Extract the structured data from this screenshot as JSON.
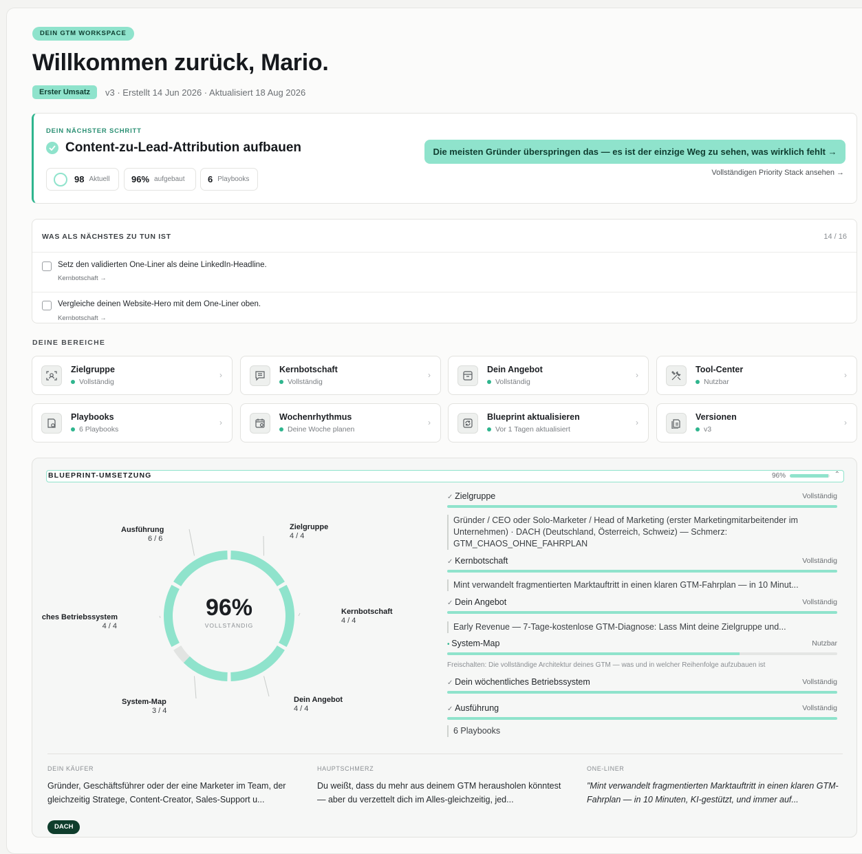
{
  "header": {
    "workspace_label": "DEIN GTM WORKSPACE",
    "title": "Willkommen zurück, Mario.",
    "phase": "Erster Umsatz",
    "meta": "v3 · Erstellt 14 Jun 2026 · Aktualisiert 18 Aug 2026"
  },
  "next_step": {
    "eyebrow": "DEIN NÄCHSTER SCHRITT",
    "title": "Content-zu-Lead-Attribution aufbauen",
    "stats": [
      {
        "value": "98",
        "label": "Aktuell"
      },
      {
        "value": "96%",
        "label": "aufgebaut"
      },
      {
        "value": "6",
        "label": "Playbooks"
      }
    ],
    "cta": "Die meisten Gründer überspringen das — es ist der einzige Weg zu sehen, was wirklich fehlt →",
    "stack_link": "Vollständigen Priority Stack ansehen →"
  },
  "todo": {
    "heading": "WAS ALS NÄCHSTES ZU TUN IST",
    "count": "14 / 16",
    "items": [
      {
        "text": "Setz den validierten One-Liner als deine LinkedIn-Headline.",
        "link": "Kernbotschaft →"
      },
      {
        "text": "Vergleiche deinen Website-Hero mit dem One-Liner oben.",
        "link": "Kernbotschaft →"
      }
    ]
  },
  "areas": {
    "heading": "DEINE BEREICHE",
    "tiles": [
      {
        "title": "Zielgruppe",
        "status": "Vollständig",
        "icon": "face-scan-icon"
      },
      {
        "title": "Kernbotschaft",
        "status": "Vollständig",
        "icon": "message-icon"
      },
      {
        "title": "Dein Angebot",
        "status": "Vollständig",
        "icon": "box-icon"
      },
      {
        "title": "Tool-Center",
        "status": "Nutzbar",
        "icon": "tools-icon"
      },
      {
        "title": "Playbooks",
        "status": "6 Playbooks",
        "icon": "playbook-icon"
      },
      {
        "title": "Wochenrhythmus",
        "status": "Deine Woche planen",
        "icon": "calendar-icon"
      },
      {
        "title": "Blueprint aktualisieren",
        "status": "Vor 1 Tagen aktualisiert",
        "icon": "refresh-icon"
      },
      {
        "title": "Versionen",
        "status": "v3",
        "icon": "versions-icon"
      }
    ]
  },
  "blueprint": {
    "heading": "BLUEPRINT-UMSETZUNG",
    "percent_label": "96%",
    "percent": 96,
    "center_value": "96%",
    "center_label": "VOLLSTÄNDIG",
    "segments": [
      {
        "name": "Zielgruppe",
        "count": "4 / 4",
        "done": 4,
        "total": 4
      },
      {
        "name": "Kernbotschaft",
        "count": "4 / 4",
        "done": 4,
        "total": 4
      },
      {
        "name": "Dein Angebot",
        "count": "4 / 4",
        "done": 4,
        "total": 4
      },
      {
        "name": "System-Map",
        "count": "3 / 4",
        "done": 3,
        "total": 4
      },
      {
        "name": "Dein wöchentliches Betriebssystem",
        "count": "4 / 4",
        "done": 4,
        "total": 4
      },
      {
        "name": "Ausführung",
        "count": "6 / 6",
        "done": 6,
        "total": 6
      }
    ],
    "sections": [
      {
        "name": "Zielgruppe",
        "state": "Vollständig",
        "progress": 100,
        "body": "Gründer / CEO oder Solo-Marketer / Head of Marketing (erster Marketingmitarbeitender im Unternehmen) · DACH (Deutschland, Österreich, Schweiz) — Schmerz: GTM_CHAOS_OHNE_FAHRPLAN"
      },
      {
        "name": "Kernbotschaft",
        "state": "Vollständig",
        "progress": 100,
        "body": "Mint verwandelt fragmentierten Marktauftritt in einen klaren GTM-Fahrplan — in 10 Minut..."
      },
      {
        "name": "Dein Angebot",
        "state": "Vollständig",
        "progress": 100,
        "body": "Early Revenue — 7-Tage-kostenlose GTM-Diagnose: Lass Mint deine Zielgruppe und..."
      },
      {
        "name": "System-Map",
        "state": "Nutzbar",
        "progress": 75,
        "note": "Freischalten: Die vollständige Architektur deines GTM — was und in welcher Reihenfolge aufzubauen ist"
      },
      {
        "name": "Dein wöchentliches Betriebssystem",
        "state": "Vollständig",
        "progress": 100
      },
      {
        "name": "Ausführung",
        "state": "Vollständig",
        "progress": 100,
        "body": "6 Playbooks"
      }
    ],
    "footer": {
      "buyer_label": "DEIN KÄUFER",
      "buyer_text": "Gründer, Geschäftsführer oder der eine Marketer im Team, der gleichzeitig Stratege, Content-Creator, Sales-Support u...",
      "pain_label": "HAUPTSCHMERZ",
      "pain_text": "Du weißt, dass du mehr aus deinem GTM herausholen könntest — aber du verzettelt dich im Alles-gleichzeitig, jed...",
      "oneliner_label": "ONE-LINER",
      "oneliner_text": "\"Mint verwandelt fragmentierten Marktauftritt in einen klaren GTM-Fahrplan — in 10 Minuten, KI-gestützt, und immer auf...",
      "region": "DACH"
    }
  },
  "colors": {
    "accent": "#8fe3cc",
    "accent_dark": "#2fb58e",
    "badge_dark": "#0f3d2c"
  }
}
